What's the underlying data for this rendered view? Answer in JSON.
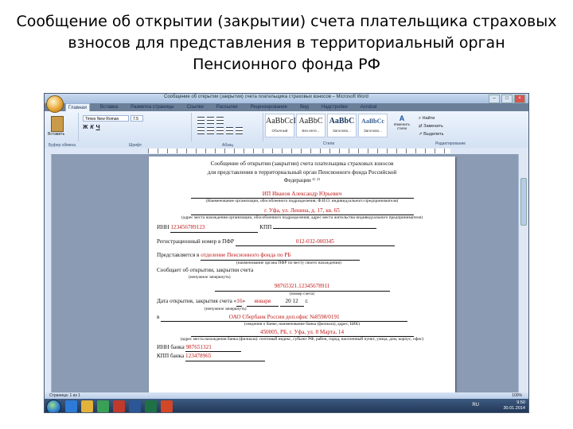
{
  "slide": {
    "title_lines": [
      "Сообщение об открытии (закрытии) счета плательщика страховых",
      "взносов для представления в территориальный орган",
      "Пенсионного фонда РФ"
    ]
  },
  "window": {
    "title": "Сообщение об открытии (закрытии) счета плательщика страховых взносов – Microsoft Word"
  },
  "ribbon": {
    "tabs": [
      "Главная",
      "Вставка",
      "Разметка страницы",
      "Ссылки",
      "Рассылки",
      "Рецензирование",
      "Вид",
      "Надстройки",
      "Acrobat"
    ],
    "font_name": "Times New Roman",
    "font_size": "7.5",
    "paste_label": "Вставить",
    "format_buttons": [
      "Ж",
      "К",
      "Ч"
    ],
    "groups": [
      "Буфер обмена",
      "Шрифт",
      "Абзац",
      "Стили",
      "Редактирование"
    ],
    "styles": [
      {
        "sample": "AaBbCcI",
        "name": "Обычный"
      },
      {
        "sample": "AaBbC",
        "name": "Без инте..."
      },
      {
        "sample": "AaBbC",
        "name": "Заголово..."
      },
      {
        "sample": "AaBbCc",
        "name": "Заголово..."
      }
    ],
    "change_styles_label": "Изменить стили",
    "edit_items": [
      "Найти",
      "Заменить",
      "Выделить"
    ]
  },
  "document": {
    "heading": [
      "Сообщение об открытии (закрытии) счета плательщика страховых взносов",
      "для представления в территориальный орган Пенсионного фонда Российской",
      "Федерации ¹⁾ ²⁾"
    ],
    "payer_name": "ИП Иванов Александр Юрьевич",
    "payer_caption": "(Наименование организации, обособленного подразделения; Ф.И.О. индивидуального предпринимателя)",
    "address": "г. Уфа, ул. Ленина, д. 17, кв. 65",
    "address_caption": "(адрес места нахождения организации, обособленного подразделения; адрес места жительства индивидуального предпринимателя)",
    "inn_label": "ИНН",
    "inn_value": "123456789123",
    "kpp_label": "КПП",
    "reg_label": "Регистрационный номер в ПФР",
    "reg_value": "012-032-000345",
    "presented_label": "Представляется в",
    "presented_value": "отделение Пенсионного фонда по РБ",
    "presented_caption": "(наименование органа ПФР по месту своего нахождения)",
    "notify_text": "Сообщает об открытии, закрытии счета",
    "notify_caption": "(ненужное зачеркнуть)",
    "account_number": "98765321.12345678911",
    "account_caption": "(номер счета)",
    "date_text": "Дата открытия, закрытия счета",
    "day": "16",
    "month": "января",
    "year": "20 12",
    "year_suffix": "г.",
    "bank_prefix": "в",
    "bank_value": "ОАО Сбербанк России доп.офис №8598/0191",
    "bank_caption": "(сведения о банке, наименование банка (филиала), адрес, БИК)",
    "bank_address": "450005, РБ, г. Уфа, ул. 8 Марта, 14",
    "bank_address_caption": "(адрес места нахождения банка (филиала): почтовый индекс, субъект РФ, район, город, населенный пункт, улица, дом, корпус, офис)",
    "bank_inn_label": "ИНН банка",
    "bank_inn_value": "987651321",
    "bank_kpp_label": "КПП банка",
    "bank_kpp_value": "123478965"
  },
  "statusbar": {
    "page": "Страница: 1 из 1",
    "zoom": "100%"
  },
  "taskbar": {
    "lang": "RU",
    "time": "9:50",
    "date": "30.01.2014"
  }
}
